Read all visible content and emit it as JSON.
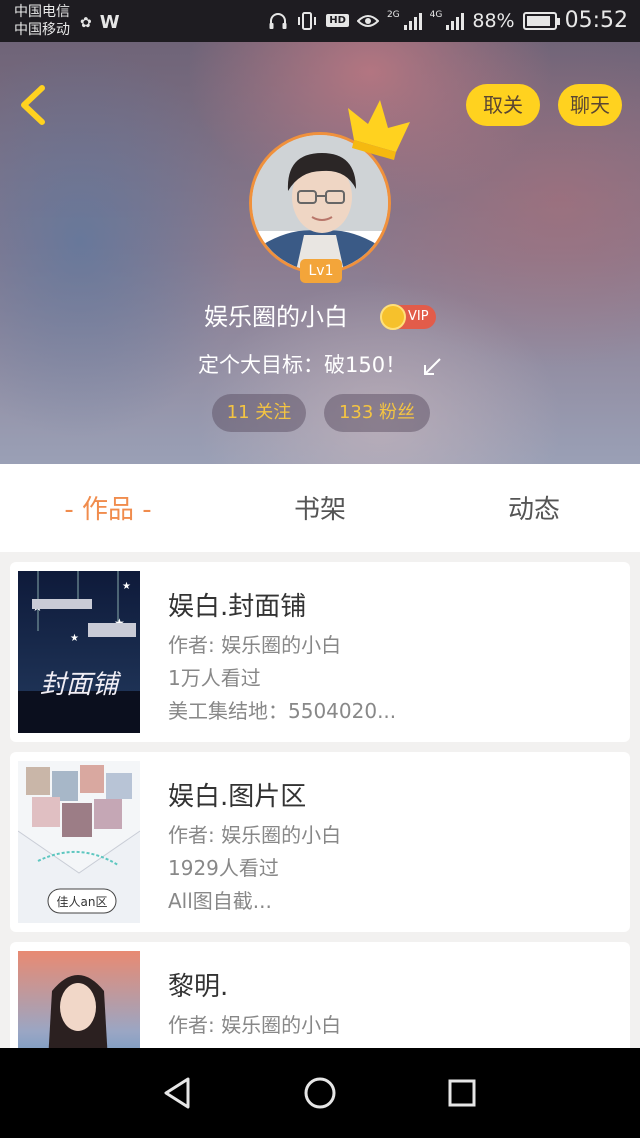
{
  "status_bar": {
    "carrier_1": "中国电信",
    "carrier_2": "中国移动",
    "left_icons": [
      "notification-icon",
      "w-app-icon"
    ],
    "right_icons": [
      "headphones-icon",
      "vibrate-icon",
      "hd-icon",
      "eye-icon",
      "signal-2g-icon",
      "signal-4g-icon"
    ],
    "hd_label": "HD",
    "net_2g": "2G",
    "net_4g": "4G",
    "battery": "88%",
    "battery_level": 0.88,
    "time": "05:52"
  },
  "header": {
    "back_icon": "chevron-left-icon",
    "unfollow_label": "取关",
    "chat_label": "聊天",
    "level": "Lv1",
    "nickname": "娱乐圈的小白",
    "vip_label": "VIP",
    "motto": "定个大目标：破150！",
    "edit_icon": "edit-arrow-icon",
    "following": "11 关注",
    "fans": "133 粉丝"
  },
  "tabs": [
    {
      "label": "- 作品 -",
      "active": true
    },
    {
      "label": "书架",
      "active": false
    },
    {
      "label": "动态",
      "active": false
    }
  ],
  "works": [
    {
      "title": "娱白.封面铺",
      "author": "作者: 娱乐圈的小白",
      "views": "1万人看过",
      "desc": "美工集结地：5504020...",
      "cover_text": "封面铺"
    },
    {
      "title": "娱白.图片区",
      "author": "作者: 娱乐圈的小白",
      "views": "1929人看过",
      "desc": "All图自截...",
      "cover_text": "佳人an区"
    },
    {
      "title": "黎明.",
      "author": "作者: 娱乐圈的小白",
      "views": "",
      "desc": ""
    }
  ],
  "nav_bar": {
    "icons": [
      "back-triangle-icon",
      "home-circle-icon",
      "recents-square-icon"
    ]
  },
  "colors": {
    "accent_orange": "#f08c4d",
    "button_yellow": "#ffd21f",
    "stat_gold": "#f4c442",
    "vip_red": "#e25c4a"
  }
}
